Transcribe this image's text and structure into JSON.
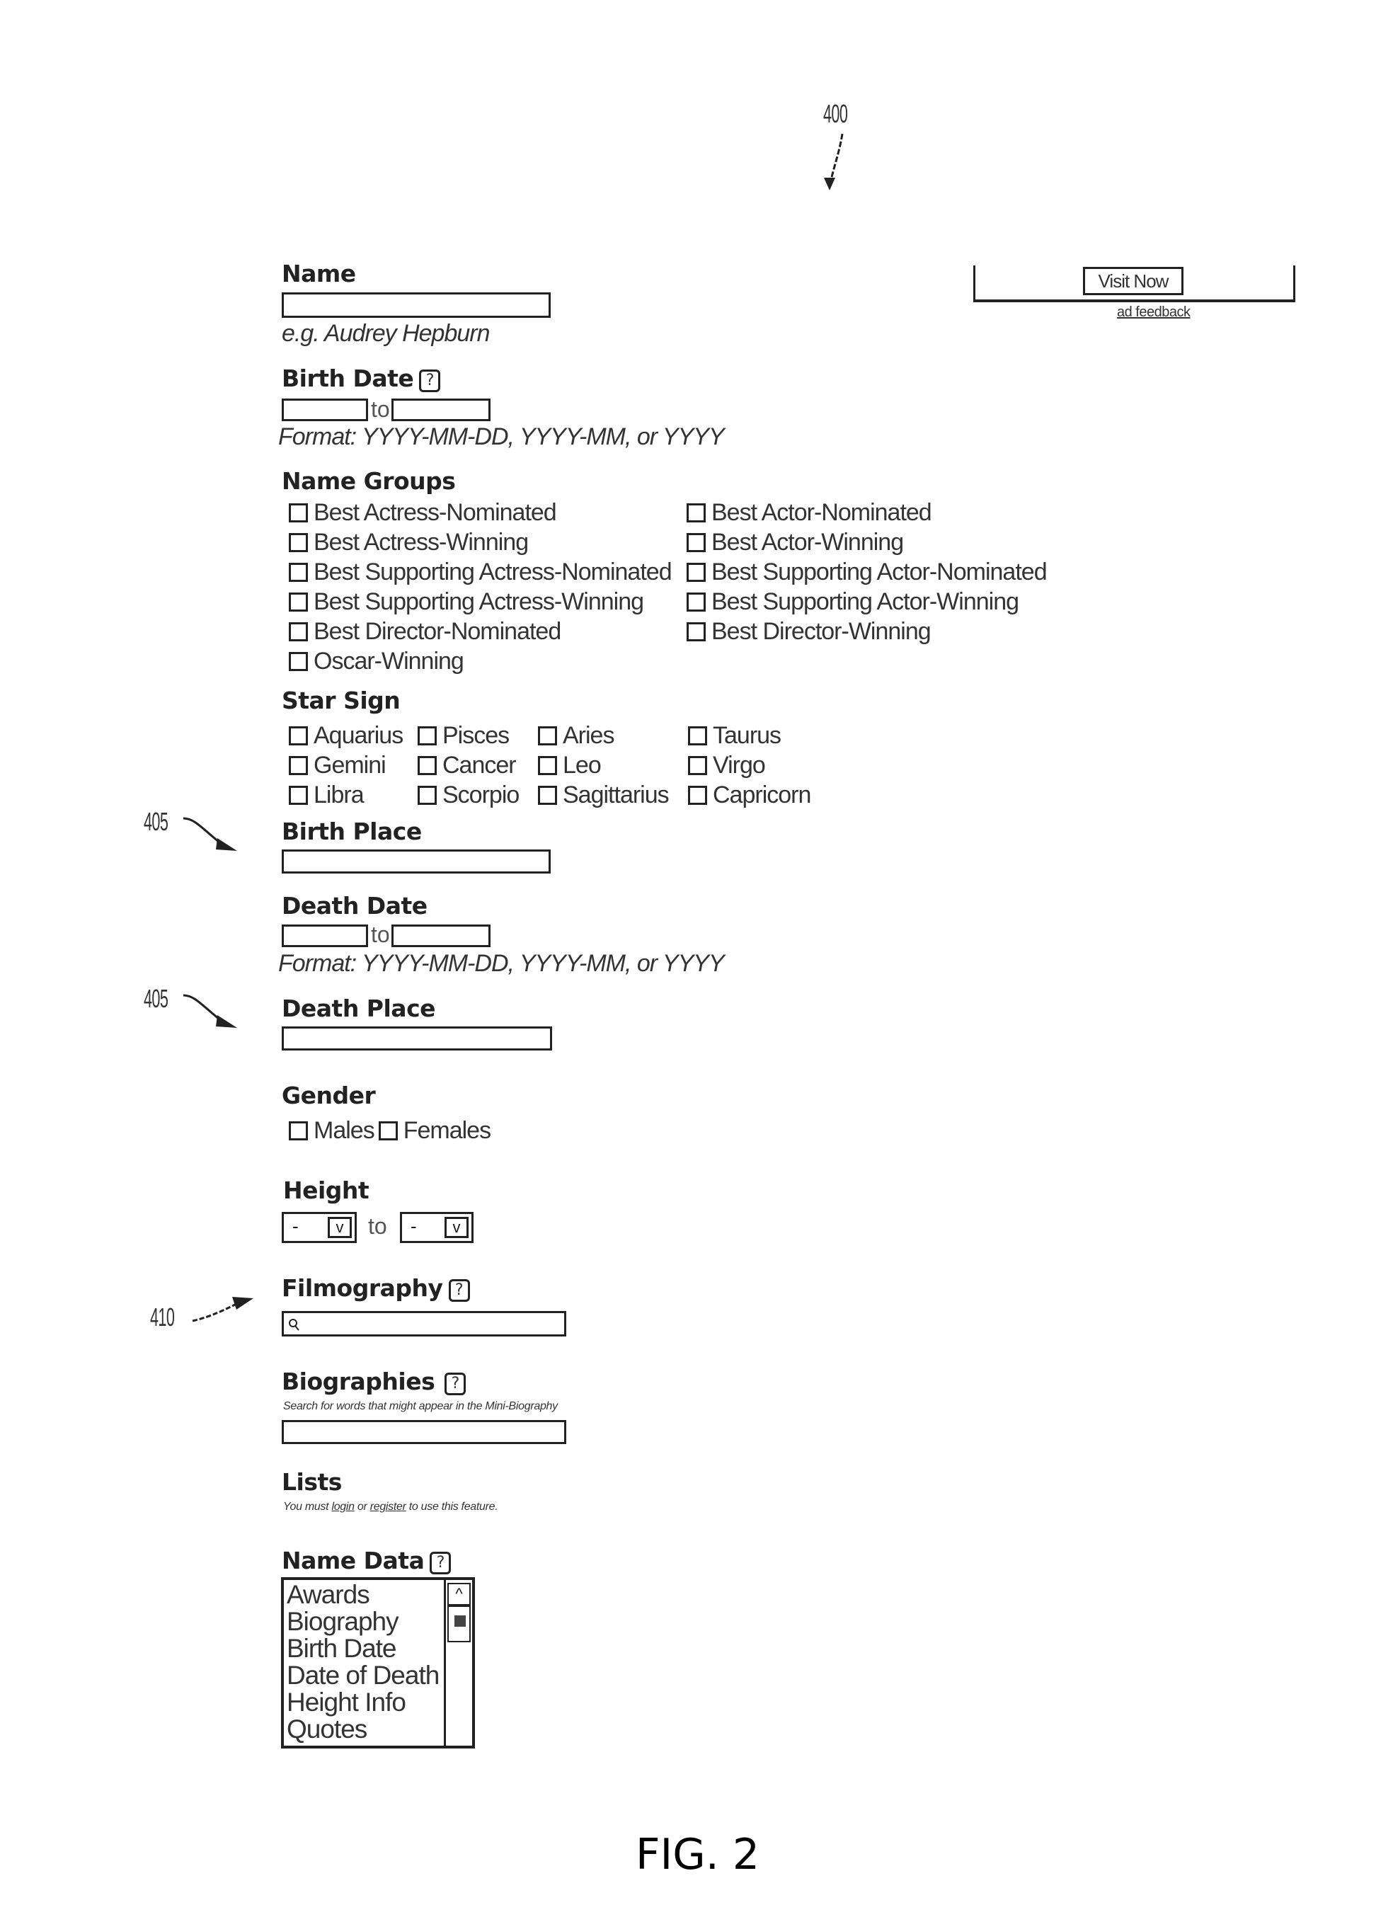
{
  "figure": {
    "label": "FIG. 2",
    "refs": {
      "main": "400",
      "birth_place": "405",
      "death_place": "405",
      "filmography": "410"
    }
  },
  "ad": {
    "button_label": "Visit Now",
    "feedback_link": "ad feedback"
  },
  "form": {
    "name": {
      "label": "Name",
      "value": "",
      "hint": "e.g. Audrey Hepburn"
    },
    "birth_date": {
      "label": "Birth Date",
      "help_icon": "?",
      "from_value": "",
      "to_label": "to",
      "to_value": "",
      "hint": "Format: YYYY-MM-DD, YYYY-MM, or YYYY"
    },
    "name_groups": {
      "label": "Name Groups",
      "options": [
        {
          "label": "Best Actress-Nominated",
          "checked": false
        },
        {
          "label": "Best Actor-Nominated",
          "checked": false
        },
        {
          "label": "Best Actress-Winning",
          "checked": false
        },
        {
          "label": "Best Actor-Winning",
          "checked": false
        },
        {
          "label": "Best Supporting Actress-Nominated",
          "checked": false
        },
        {
          "label": "Best Supporting Actor-Nominated",
          "checked": false
        },
        {
          "label": "Best Supporting Actress-Winning",
          "checked": false
        },
        {
          "label": "Best Supporting Actor-Winning",
          "checked": false
        },
        {
          "label": "Best Director-Nominated",
          "checked": false
        },
        {
          "label": "Best Director-Winning",
          "checked": false
        },
        {
          "label": "Oscar-Winning",
          "checked": false
        }
      ]
    },
    "star_sign": {
      "label": "Star Sign",
      "options": [
        {
          "label": "Aquarius",
          "checked": false
        },
        {
          "label": "Pisces",
          "checked": false
        },
        {
          "label": "Aries",
          "checked": false
        },
        {
          "label": "Taurus",
          "checked": false
        },
        {
          "label": "Gemini",
          "checked": false
        },
        {
          "label": "Cancer",
          "checked": false
        },
        {
          "label": "Leo",
          "checked": false
        },
        {
          "label": "Virgo",
          "checked": false
        },
        {
          "label": "Libra",
          "checked": false
        },
        {
          "label": "Scorpio",
          "checked": false
        },
        {
          "label": "Sagittarius",
          "checked": false
        },
        {
          "label": "Capricorn",
          "checked": false
        }
      ]
    },
    "birth_place": {
      "label": "Birth Place",
      "value": ""
    },
    "death_date": {
      "label": "Death Date",
      "from_value": "",
      "to_label": "to",
      "to_value": "",
      "hint": "Format: YYYY-MM-DD, YYYY-MM, or YYYY"
    },
    "death_place": {
      "label": "Death Place",
      "value": ""
    },
    "gender": {
      "label": "Gender",
      "options": [
        {
          "label": "Males",
          "checked": false
        },
        {
          "label": "Females",
          "checked": false
        }
      ]
    },
    "height": {
      "label": "Height",
      "from_selected": "-",
      "to_label": "to",
      "to_selected": "-"
    },
    "filmography": {
      "label": "Filmography",
      "help_icon": "?",
      "value": "",
      "search_icon": "search-icon"
    },
    "biographies": {
      "label": "Biographies",
      "help_icon": "?",
      "hint": "Search for words that might appear in the Mini-Biography",
      "value": ""
    },
    "lists": {
      "label": "Lists",
      "hint_prefix": "You must ",
      "login_link": "login",
      "hint_mid": " or ",
      "register_link": "register",
      "hint_suffix": " to use this feature."
    },
    "name_data": {
      "label": "Name Data",
      "help_icon": "?",
      "options": [
        "Awards",
        "Biography",
        "Birth Date",
        "Date of Death",
        "Height Info",
        "Quotes"
      ]
    }
  }
}
